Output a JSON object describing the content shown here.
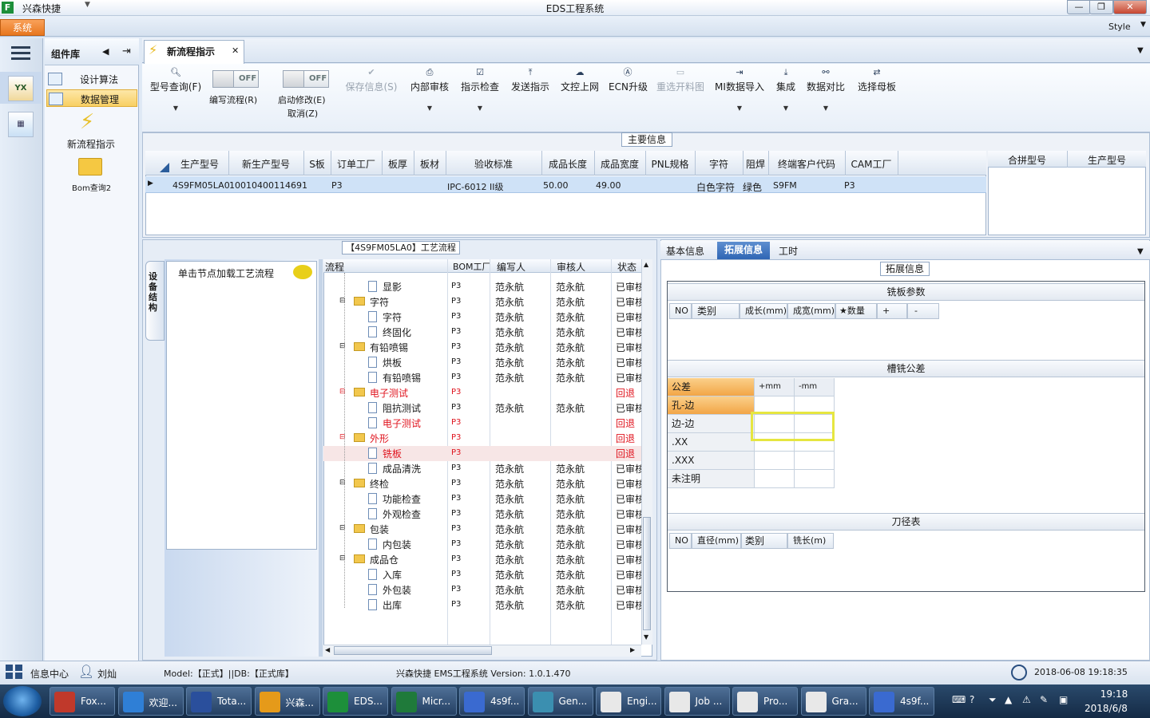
{
  "window": {
    "app_name": "兴森快捷",
    "title": "EDS工程系统",
    "minimize": "—",
    "maximize": "❐",
    "close": "✕"
  },
  "menu": {
    "system": "系统",
    "style_label": "Style"
  },
  "component_library": {
    "title": "组件库",
    "items": [
      {
        "label": "设计算法"
      },
      {
        "label": "数据管理"
      },
      {
        "label": "新流程指示"
      },
      {
        "label": "Bom查询2"
      }
    ]
  },
  "doc_tab": {
    "label": "新流程指示"
  },
  "toolbar": {
    "model_query": "型号查询(F)",
    "edit_flow": "编写流程(R)",
    "edit_flow_state": "OFF",
    "start_modify": "启动修改(E)",
    "start_modify_state": "OFF",
    "cancel": "取消(Z)",
    "save_info": "保存信息(S)",
    "internal_review": "内部审核",
    "instruction_check": "指示检查",
    "send_instruction": "发送指示",
    "doc_upload": "文控上网",
    "ecn_upgrade": "ECN升级",
    "reselect_material": "重选开料图",
    "mi_import": "MI数据导入",
    "integrate": "集成",
    "data_compare": "数据对比",
    "select_master": "选择母板"
  },
  "main_info": {
    "title": "主要信息",
    "columns": [
      "生产型号",
      "新生产型号",
      "S板",
      "订单工厂",
      "板厚",
      "板材",
      "验收标准",
      "成品长度",
      "成品宽度",
      "PNL规格",
      "字符",
      "阻焊",
      "终端客户代码",
      "CAM工厂"
    ],
    "row": {
      "model": "4S9FM05LA0",
      "new_model": "10010400114691",
      "factory": "P3",
      "standard": "IPC-6012 II级",
      "length": "50.00",
      "width": "49.00",
      "char": "白色字符",
      "mask": "绿色",
      "customer": "S9FM",
      "cam": "P3"
    },
    "right_columns": [
      "合拼型号",
      "生产型号"
    ]
  },
  "flow": {
    "title": "【4S9FM05LA0】工艺流程",
    "side_tab": "设备结构",
    "load_hint": "单击节点加载工艺流程",
    "columns": [
      "流程",
      "BOM工厂",
      "编写人",
      "审核人",
      "状态"
    ],
    "rows": [
      {
        "name": "显影",
        "level": 2,
        "bom": "P3",
        "author": "范永航",
        "reviewer": "范永航",
        "status": "已审核",
        "red": false,
        "sel": false
      },
      {
        "name": "字符",
        "level": 1,
        "bom": "P3",
        "author": "范永航",
        "reviewer": "范永航",
        "status": "已审核",
        "red": false,
        "sel": false
      },
      {
        "name": "字符",
        "level": 2,
        "bom": "P3",
        "author": "范永航",
        "reviewer": "范永航",
        "status": "已审核",
        "red": false,
        "sel": false
      },
      {
        "name": "终固化",
        "level": 2,
        "bom": "P3",
        "author": "范永航",
        "reviewer": "范永航",
        "status": "已审核",
        "red": false,
        "sel": false
      },
      {
        "name": "有铅喷锡",
        "level": 1,
        "bom": "P3",
        "author": "范永航",
        "reviewer": "范永航",
        "status": "已审核",
        "red": false,
        "sel": false
      },
      {
        "name": "烘板",
        "level": 2,
        "bom": "P3",
        "author": "范永航",
        "reviewer": "范永航",
        "status": "已审核",
        "red": false,
        "sel": false
      },
      {
        "name": "有铅喷锡",
        "level": 2,
        "bom": "P3",
        "author": "范永航",
        "reviewer": "范永航",
        "status": "已审核",
        "red": false,
        "sel": false
      },
      {
        "name": "电子测试",
        "level": 1,
        "bom": "P3",
        "author": "",
        "reviewer": "",
        "status": "回退",
        "red": true,
        "sel": false
      },
      {
        "name": "阻抗测试",
        "level": 2,
        "bom": "P3",
        "author": "范永航",
        "reviewer": "范永航",
        "status": "已审核",
        "red": false,
        "sel": false
      },
      {
        "name": "电子测试",
        "level": 2,
        "bom": "P3",
        "author": "",
        "reviewer": "",
        "status": "回退",
        "red": true,
        "sel": false
      },
      {
        "name": "外形",
        "level": 1,
        "bom": "P3",
        "author": "",
        "reviewer": "",
        "status": "回退",
        "red": true,
        "sel": false
      },
      {
        "name": "铣板",
        "level": 2,
        "bom": "P3",
        "author": "",
        "reviewer": "",
        "status": "回退",
        "red": true,
        "sel": true
      },
      {
        "name": "成品清洗",
        "level": 2,
        "bom": "P3",
        "author": "范永航",
        "reviewer": "范永航",
        "status": "已审核",
        "red": false,
        "sel": false
      },
      {
        "name": "终检",
        "level": 1,
        "bom": "P3",
        "author": "范永航",
        "reviewer": "范永航",
        "status": "已审核",
        "red": false,
        "sel": false
      },
      {
        "name": "功能检查",
        "level": 2,
        "bom": "P3",
        "author": "范永航",
        "reviewer": "范永航",
        "status": "已审核",
        "red": false,
        "sel": false
      },
      {
        "name": "外观检查",
        "level": 2,
        "bom": "P3",
        "author": "范永航",
        "reviewer": "范永航",
        "status": "已审核",
        "red": false,
        "sel": false
      },
      {
        "name": "包装",
        "level": 1,
        "bom": "P3",
        "author": "范永航",
        "reviewer": "范永航",
        "status": "已审核",
        "red": false,
        "sel": false
      },
      {
        "name": "内包装",
        "level": 2,
        "bom": "P3",
        "author": "范永航",
        "reviewer": "范永航",
        "status": "已审核",
        "red": false,
        "sel": false
      },
      {
        "name": "成品仓",
        "level": 1,
        "bom": "P3",
        "author": "范永航",
        "reviewer": "范永航",
        "status": "已审核",
        "red": false,
        "sel": false
      },
      {
        "name": "入库",
        "level": 2,
        "bom": "P3",
        "author": "范永航",
        "reviewer": "范永航",
        "status": "已审核",
        "red": false,
        "sel": false
      },
      {
        "name": "外包装",
        "level": 2,
        "bom": "P3",
        "author": "范永航",
        "reviewer": "范永航",
        "status": "已审核",
        "red": false,
        "sel": false
      },
      {
        "name": "出库",
        "level": 2,
        "bom": "P3",
        "author": "范永航",
        "reviewer": "范永航",
        "status": "已审核",
        "red": false,
        "sel": false
      }
    ]
  },
  "ext": {
    "tabs": [
      "基本信息",
      "拓展信息",
      "工时"
    ],
    "title": "拓展信息",
    "milling": {
      "title": "铣板参数",
      "columns": [
        "NO",
        "类别",
        "成长(mm)",
        "成宽(mm)",
        "★数量",
        "+",
        "-"
      ]
    },
    "tolerance": {
      "title": "槽铣公差",
      "head": [
        "公差",
        "+mm",
        "-mm"
      ],
      "rows": [
        "孔-边",
        "边-边",
        ".XX",
        ".XXX",
        "未注明"
      ]
    },
    "cutter": {
      "title": "刀径表",
      "columns": [
        "NO",
        "直径(mm)",
        "类别",
        "铣长(m)"
      ]
    }
  },
  "statusbar": {
    "info_center": "信息中心",
    "user": "刘灿",
    "model": "Model:【正式】||DB:【正式库】",
    "version": "兴森快捷 EMS工程系统 Version: 1.0.1.470",
    "datetime": "2018-06-08 19:18:35"
  },
  "taskbar": {
    "tasks": [
      "Fox...",
      "欢迎...",
      "Tota...",
      "兴森...",
      "EDS...",
      "Micr...",
      "4s9f...",
      "Gen...",
      "Engi...",
      "Job ...",
      "Pro...",
      "Gra...",
      "4s9f..."
    ],
    "time": "19:18",
    "date": "2018/6/8"
  },
  "colors": {
    "accent": "#2f65b4",
    "system_menu": "#e7761e",
    "rejected": "#e0141e",
    "highlight": "#e6e640"
  }
}
